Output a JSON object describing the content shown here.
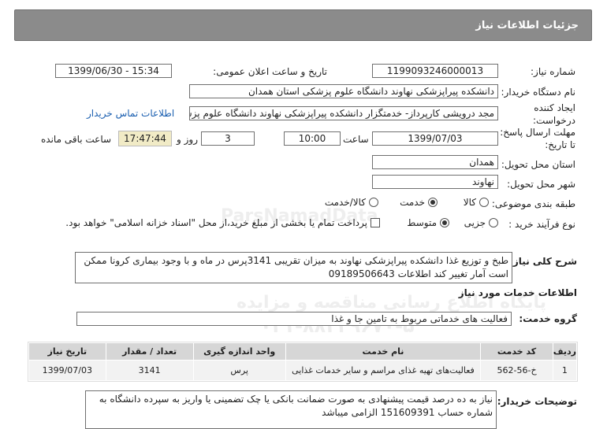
{
  "header": {
    "title": "جزئیات اطلاعات نیاز"
  },
  "need_number": {
    "label": "شماره نیاز:",
    "value": "1199093246000013"
  },
  "announce_date": {
    "label": "تاریخ و ساعت اعلان عمومی:",
    "value": "1399/06/30 - 15:34"
  },
  "buyer_org": {
    "label": "نام دستگاه خریدار:",
    "value": "دانشکده پیراپزشکی نهاوند دانشگاه علوم پزشکی استان همدان"
  },
  "requester": {
    "label_line1": "ایجاد کننده",
    "label_line2": "درخواست:",
    "value": "مجد درویشی کارپرداز- خدمتگزار دانشکده پیراپزشکی نهاوند دانشگاه علوم پزشکی",
    "contact_link": "اطلاعات تماس خریدار"
  },
  "deadline": {
    "label_line1": "مهلت ارسال پاسخ:",
    "label_line2": "تا تاریخ:",
    "date": "1399/07/03",
    "time_label": "ساعت",
    "time": "10:00",
    "days": "3",
    "days_label": "روز و",
    "remaining_time": "17:47:44",
    "remaining_label": "ساعت باقی مانده"
  },
  "delivery_province": {
    "label": "استان محل تحویل:",
    "value": "همدان"
  },
  "delivery_city": {
    "label": "شهر محل تحویل:",
    "value": "نهاوند"
  },
  "category": {
    "label": "طبقه بندی موضوعی:",
    "options": [
      "کالا",
      "خدمت",
      "کالا/خدمت"
    ],
    "selected": "خدمت"
  },
  "process": {
    "label": "نوع فرآیند خرید :",
    "options": [
      "جزیی",
      "متوسط"
    ],
    "selected": "متوسط",
    "payment_note": "پرداخت تمام یا بخشی از مبلغ خرید،از محل \"اسناد خزانه اسلامی\" خواهد بود."
  },
  "description": {
    "label": "شرح کلی نیاز:",
    "value": "طبخ و توزیع غذا دانشکده پیراپزشکی نهاوند به میزان تقریبی 3141پرس در ماه و با وجود بیماری کرونا ممکن است آمار تغییر کند اطلاعات 09189506643"
  },
  "services_info": {
    "title": "اطلاعات خدمات مورد نیاز"
  },
  "service_group": {
    "label": "گروه خدمت:",
    "value": "فعالیت های خدماتی مربوط به تامین جا و غذا"
  },
  "table": {
    "headers": [
      "ردیف",
      "کد خدمت",
      "نام خدمت",
      "واحد اندازه گیری",
      "تعداد / مقدار",
      "تاریخ نیاز"
    ],
    "rows": [
      [
        "1",
        "خ-56-562",
        "فعالیت‌های تهیه غذای مراسم و سایر خدمات غذایی",
        "پرس",
        "3141",
        "1399/07/03"
      ]
    ]
  },
  "buyer_notes": {
    "label": "توضیحات خریدار:",
    "value": "نیاز به ده درصد قیمت پیشنهادی به صورت ضمانت بانکی یا چک تضمینی یا واریز به سپرده دانشگاه به شماره حساب 151609391 الزامی میباشد"
  },
  "watermark": {
    "brand": "ParsNamadData",
    "line1": "پایگاه اطلاع رسانی مناقصه و مزایده",
    "line2": "۰۲۱-۸۸۳۴۹۶۷۰-۵"
  }
}
